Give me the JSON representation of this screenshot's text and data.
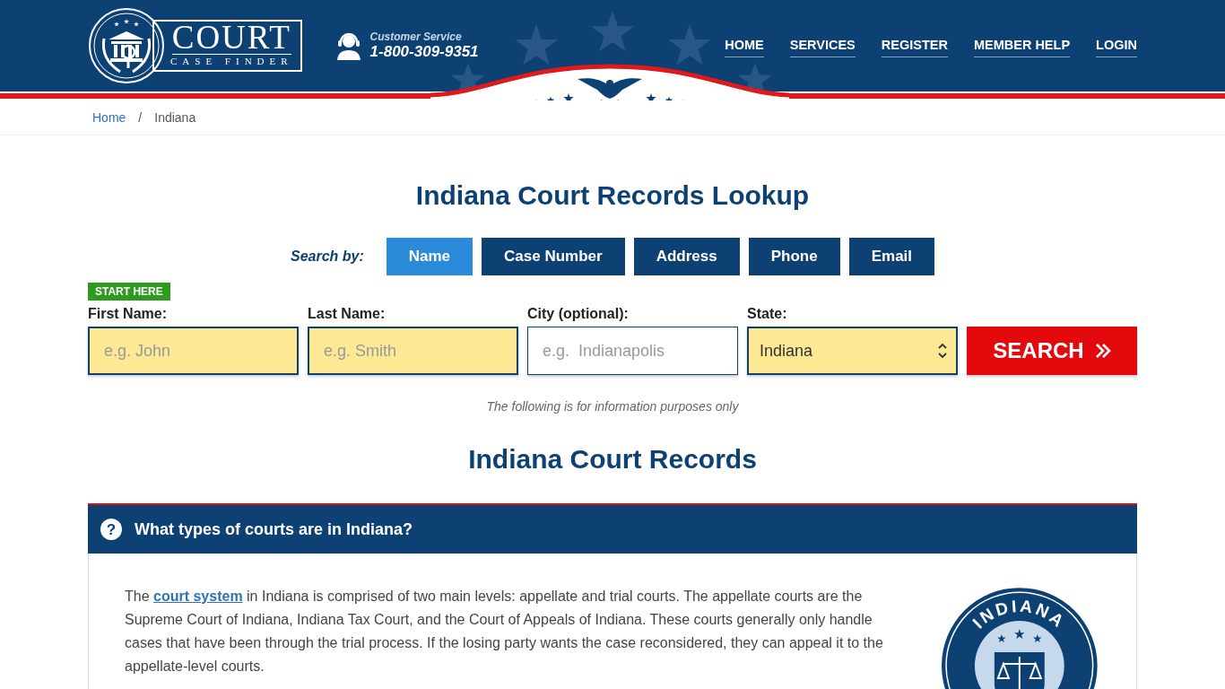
{
  "header": {
    "logo": {
      "title": "COURT",
      "subtitle": "CASE FINDER"
    },
    "customer_service": {
      "label": "Customer Service",
      "phone": "1-800-309-9351"
    },
    "nav": [
      {
        "label": "HOME"
      },
      {
        "label": "SERVICES"
      },
      {
        "label": "REGISTER"
      },
      {
        "label": "MEMBER HELP"
      },
      {
        "label": "LOGIN"
      }
    ]
  },
  "breadcrumb": [
    {
      "label": "Home",
      "kind": "link"
    },
    {
      "label": "Indiana",
      "kind": "current"
    }
  ],
  "breadcrumb_separator": "/",
  "search": {
    "title": "Indiana Court Records Lookup",
    "search_by": "Search by:",
    "tabs": [
      {
        "label": "Name",
        "selected": true
      },
      {
        "label": "Case Number",
        "selected": false
      },
      {
        "label": "Address",
        "selected": false
      },
      {
        "label": "Phone",
        "selected": false
      },
      {
        "label": "Email",
        "selected": false
      }
    ],
    "badge": "START HERE",
    "fields": [
      {
        "kind": "text",
        "label": "First Name:",
        "placeholder": "e.g. John",
        "highlighted": true
      },
      {
        "kind": "text",
        "label": "Last Name:",
        "placeholder": "e.g. Smith",
        "highlighted": true
      },
      {
        "kind": "text",
        "label": "City (optional):",
        "placeholder": "e.g.  Indianapolis",
        "highlighted": false
      },
      {
        "kind": "select",
        "label": "State:",
        "value": "Indiana",
        "highlighted": true
      }
    ],
    "button": "SEARCH",
    "note": "The following is for information purposes only"
  },
  "section_title": "Indiana Court Records",
  "faq": {
    "question": "What types of courts are in Indiana?",
    "question_icon": "?",
    "paragraph": [
      {
        "text": "The "
      },
      {
        "text": "court system",
        "link": true
      },
      {
        "text": " in Indiana is comprised of two main levels: appellate and trial courts. The appellate courts are the Supreme Court of Indiana, Indiana Tax Court, and the Court of Appeals of Indiana. These courts generally only handle cases that have been through the trial process. If the losing party wants the case reconsidered, they can appeal it to the appellate-level courts."
      }
    ],
    "seal": {
      "title": "INDIANA"
    }
  }
}
